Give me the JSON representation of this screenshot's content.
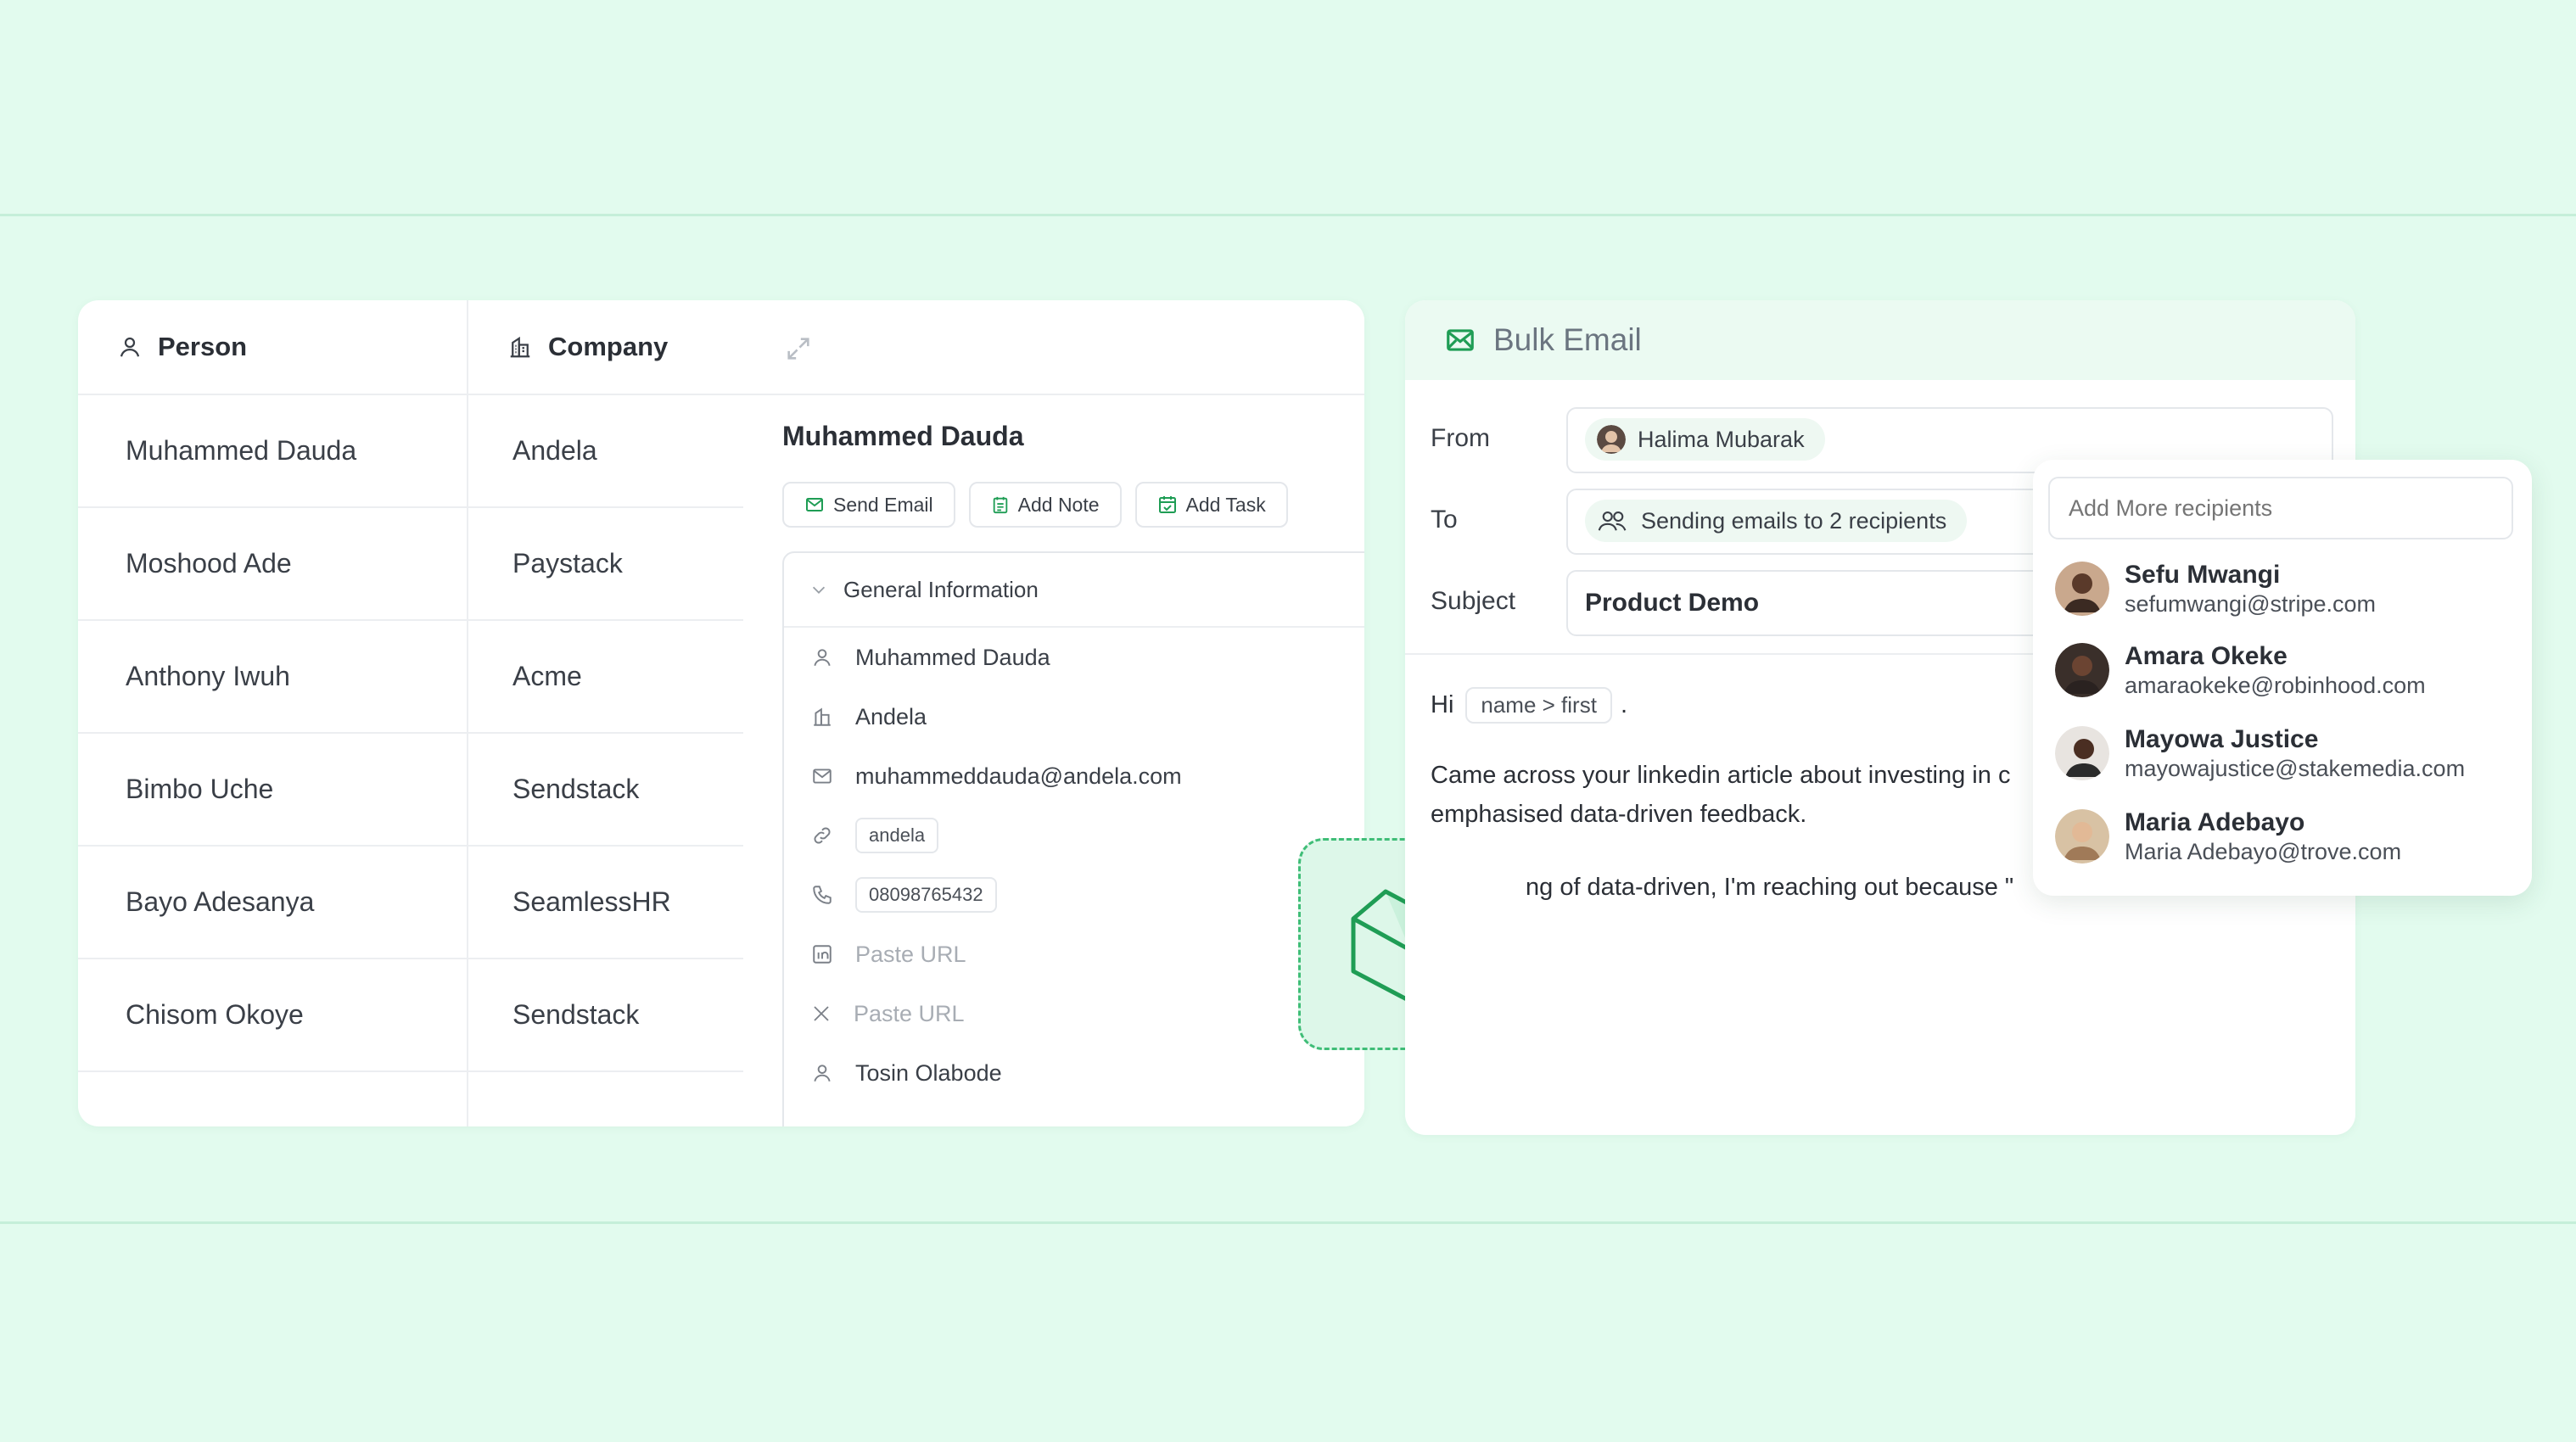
{
  "table": {
    "headers": {
      "person": "Person",
      "company": "Company"
    },
    "rows": [
      {
        "person": "Muhammed Dauda",
        "company": "Andela"
      },
      {
        "person": "Moshood Ade",
        "company": "Paystack"
      },
      {
        "person": "Anthony Iwuh",
        "company": "Acme"
      },
      {
        "person": "Bimbo Uche",
        "company": "Sendstack"
      },
      {
        "person": "Bayo Adesanya",
        "company": "SeamlessHR"
      },
      {
        "person": "Chisom Okoye",
        "company": "Sendstack"
      }
    ]
  },
  "detail": {
    "name": "Muhammed Dauda",
    "actions": {
      "send_email": "Send Email",
      "add_note": "Add Note",
      "add_task": "Add Task"
    },
    "section_title": "General Information",
    "fields": {
      "name": "Muhammed Dauda",
      "company": "Andela",
      "email": "muhammeddauda@andela.com",
      "website": "andela",
      "phone": "08098765432",
      "linkedin_placeholder": "Paste URL",
      "x_placeholder": "Paste URL",
      "owner": "Tosin Olabode"
    }
  },
  "email": {
    "title": "Bulk Email",
    "from_label": "From",
    "from_value": "Halima Mubarak",
    "to_label": "To",
    "to_value": "Sending emails to 2 recipients",
    "subject_label": "Subject",
    "subject_value": "Product Demo",
    "greeting": "Hi",
    "variable": "name > first",
    "greeting_end": ".",
    "body_line1": "Came across your linkedin article about investing in c",
    "body_line2": "emphasised data-driven feedback.",
    "body_line3": "ng of data-driven, I'm reaching out because \""
  },
  "recipients": {
    "placeholder": "Add More recipients",
    "items": [
      {
        "name": "Sefu Mwangi",
        "email": "sefumwangi@stripe.com"
      },
      {
        "name": "Amara Okeke",
        "email": "amaraokeke@robinhood.com"
      },
      {
        "name": "Mayowa Justice",
        "email": "mayowajustice@stakemedia.com"
      },
      {
        "name": "Maria Adebayo",
        "email": "Maria Adebayo@trove.com"
      }
    ]
  },
  "colors": {
    "background": "#e2fbee",
    "accent_green": "#1f9d55",
    "email_header_bg": "#ebfaf2"
  }
}
